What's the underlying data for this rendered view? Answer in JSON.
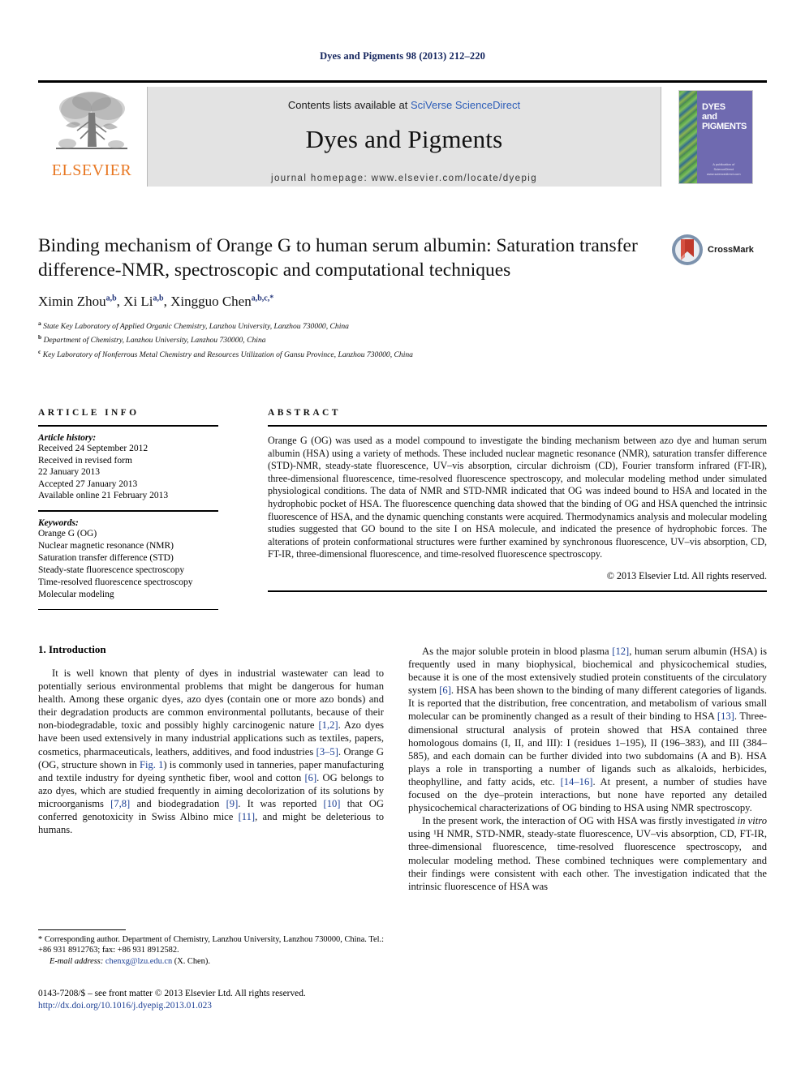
{
  "running_head": "Dyes and Pigments 98 (2013) 212–220",
  "masthead": {
    "publisher_wordmark": "ELSEVIER",
    "contents_prefix": "Contents lists available at ",
    "contents_link": "SciVerse ScienceDirect",
    "journal_title": "Dyes and Pigments",
    "homepage": "journal homepage: www.elsevier.com/locate/dyepig",
    "cover": {
      "line1": "DYES",
      "line2": "and",
      "line3": "PIGMENTS",
      "footer_line1": "A publication of",
      "footer_line2": "ScienceDirect",
      "footer_line3": "www.sciencedirect.com"
    }
  },
  "article": {
    "title": "Binding mechanism of Orange G to human serum albumin: Saturation transfer difference-NMR, spectroscopic and computational techniques",
    "crossmark_label": "CrossMark",
    "authors": [
      {
        "name": "Ximin Zhou",
        "marks": "a,b"
      },
      {
        "name": "Xi Li",
        "marks": "a,b"
      },
      {
        "name": "Xingguo Chen",
        "marks": "a,b,c,*"
      }
    ],
    "affiliations": [
      {
        "mark": "a",
        "text": "State Key Laboratory of Applied Organic Chemistry, Lanzhou University, Lanzhou 730000, China"
      },
      {
        "mark": "b",
        "text": "Department of Chemistry, Lanzhou University, Lanzhou 730000, China"
      },
      {
        "mark": "c",
        "text": "Key Laboratory of Nonferrous Metal Chemistry and Resources Utilization of Gansu Province, Lanzhou 730000, China"
      }
    ]
  },
  "article_info": {
    "heading": "ARTICLE INFO",
    "history_label": "Article history:",
    "history": [
      "Received 24 September 2012",
      "Received in revised form",
      "22 January 2013",
      "Accepted 27 January 2013",
      "Available online 21 February 2013"
    ],
    "keywords_label": "Keywords:",
    "keywords": [
      "Orange G (OG)",
      "Nuclear magnetic resonance (NMR)",
      "Saturation transfer difference (STD)",
      "Steady-state fluorescence spectroscopy",
      "Time-resolved fluorescence spectroscopy",
      "Molecular modeling"
    ]
  },
  "abstract": {
    "heading": "ABSTRACT",
    "body": "Orange G (OG) was used as a model compound to investigate the binding mechanism between azo dye and human serum albumin (HSA) using a variety of methods. These included nuclear magnetic resonance (NMR), saturation transfer difference (STD)-NMR, steady-state fluorescence, UV–vis absorption, circular dichroism (CD), Fourier transform infrared (FT-IR), three-dimensional fluorescence, time-resolved fluorescence spectroscopy, and molecular modeling method under simulated physiological conditions. The data of NMR and STD-NMR indicated that OG was indeed bound to HSA and located in the hydrophobic pocket of HSA. The fluorescence quenching data showed that the binding of OG and HSA quenched the intrinsic fluorescence of HSA, and the dynamic quenching constants were acquired. Thermodynamics analysis and molecular modeling studies suggested that GO bound to the site I on HSA molecule, and indicated the presence of hydrophobic forces. The alterations of protein conformational structures were further examined by synchronous fluorescence, UV–vis absorption, CD, FT-IR, three-dimensional fluorescence, and time-resolved fluorescence spectroscopy.",
    "copyright": "© 2013 Elsevier Ltd. All rights reserved."
  },
  "body": {
    "section1_heading": "1.  Introduction",
    "left_para1_a": "It is well known that plenty of dyes in industrial wastewater can lead to potentially serious environmental problems that might be dangerous for human health. Among these organic dyes, azo dyes (contain one or more azo bonds) and their degradation products are common environmental pollutants, because of their non-biodegradable, toxic and possibly highly carcinogenic nature ",
    "cite_1_2": "[1,2]",
    "left_para1_b": ". Azo dyes have been used extensively in many industrial applications such as textiles, papers, cosmetics, pharmaceuticals, leathers, additives, and food industries ",
    "cite_3_5": "[3–5]",
    "left_para1_c": ". Orange G (OG, structure shown in ",
    "cite_fig1": "Fig. 1",
    "left_para1_d": ") is commonly used in tanneries, paper manufacturing and textile industry for dyeing synthetic fiber, wool and cotton ",
    "cite_6": "[6]",
    "left_para1_e": ". OG belongs to azo dyes, which are studied frequently in aiming decolorization of its solutions by microorganisms ",
    "cite_7_8": "[7,8]",
    "left_para1_f": " and biodegradation ",
    "cite_9": "[9]",
    "left_para1_g": ". It was reported ",
    "cite_10": "[10]",
    "left_para1_h": " that OG conferred genotoxicity in Swiss Albino mice ",
    "cite_11": "[11]",
    "left_para1_i": ", and might be deleterious to humans.",
    "right_para1_a": "As the major soluble protein in blood plasma ",
    "cite_12": "[12]",
    "right_para1_b": ", human serum albumin (HSA) is frequently used in many biophysical, biochemical and physicochemical studies, because it is one of the most extensively studied protein constituents of the circulatory system ",
    "cite_6b": "[6]",
    "right_para1_c": ". HSA has been shown to the binding of many different categories of ligands. It is reported that the distribution, free concentration, and metabolism of various small molecular can be prominently changed as a result of their binding to HSA ",
    "cite_13": "[13]",
    "right_para1_d": ". Three-dimensional structural analysis of protein showed that HSA contained three homologous domains (I, II, and III): I (residues 1–195), II (196–383), and III (384–585), and each domain can be further divided into two subdomains (A and B). HSA plays a role in transporting a number of ligands such as alkaloids, herbicides, theophylline, and fatty acids, etc. ",
    "cite_14_16": "[14–16]",
    "right_para1_e": ". At present, a number of studies have focused on the dye–protein interactions, but none have reported any detailed physicochemical characterizations of OG binding to HSA using NMR spectroscopy.",
    "right_para2_a": "In the present work, the interaction of OG with HSA was firstly investigated ",
    "right_para2_italic": "in vitro",
    "right_para2_b": " using ¹H NMR, STD-NMR, steady-state fluorescence, UV–vis absorption, CD, FT-IR, three-dimensional fluorescence, time-resolved fluorescence spectroscopy, and molecular modeling method. These combined techniques were complementary and their findings were consistent with each other. The investigation indicated that the intrinsic fluorescence of HSA was"
  },
  "footnote": {
    "corresponding_mark": "*",
    "corresponding_text": " Corresponding author. Department of Chemistry, Lanzhou University, Lanzhou 730000, China. Tel.: +86 931 8912763; fax: +86 931 8912582.",
    "email_label": "E-mail address:",
    "email": "chenxg@lzu.edu.cn",
    "email_suffix": " (X. Chen)."
  },
  "imprint": {
    "issn_line": "0143-7208/$ – see front matter © 2013 Elsevier Ltd. All rights reserved.",
    "doi": "http://dx.doi.org/10.1016/j.dyepig.2013.01.023"
  },
  "colors": {
    "link_blue": "#1c3f94",
    "header_navy": "#12235c",
    "elsevier_orange": "#E87722",
    "banner_gray": "#e3e3e3",
    "cover_purple": "#6f6ab0"
  }
}
